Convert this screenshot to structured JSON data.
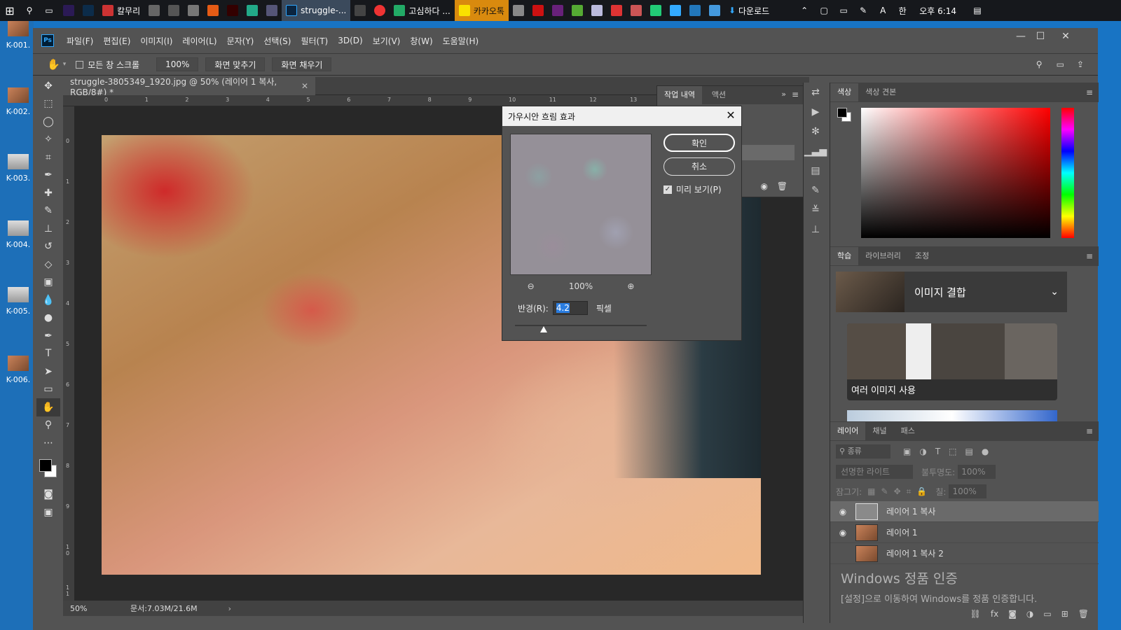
{
  "taskbar": {
    "apps": [
      "칼무리",
      "struggle-...",
      "고심하다 ...",
      "카카오톡",
      "다운로드"
    ],
    "time": "오후 6:14"
  },
  "desktop": {
    "icons": [
      "K-001.",
      "K-002.",
      "K-003.",
      "K-004.",
      "K-005.",
      "K-006."
    ]
  },
  "menubar": {
    "logo": "Ps",
    "items": [
      "파일(F)",
      "편집(E)",
      "이미지(I)",
      "레이어(L)",
      "문자(Y)",
      "선택(S)",
      "필터(T)",
      "3D(D)",
      "보기(V)",
      "창(W)",
      "도움말(H)"
    ]
  },
  "options": {
    "scroll_all_windows": "모든 창 스크롤",
    "zoom": "100%",
    "fit_screen": "화면 맞추기",
    "fill_screen": "화면 채우기"
  },
  "document": {
    "tab_title": "struggle-3805349_1920.jpg @ 50% (레이어 1 복사, RGB/8#) *",
    "zoom": "50%",
    "doc_size": "문서:7.03M/21.6M"
  },
  "rulers": {
    "top": [
      "0",
      "1",
      "2",
      "3",
      "4",
      "5",
      "6",
      "7",
      "8",
      "9",
      "10",
      "11",
      "12",
      "13"
    ],
    "left": [
      "0",
      "1",
      "2",
      "3",
      "4",
      "5",
      "6",
      "7",
      "8",
      "9",
      "1 0",
      "1 1"
    ]
  },
  "history_panel": {
    "tabs": [
      "작업 내역",
      "액션"
    ]
  },
  "dialog": {
    "title": "가우시안 흐림 효과",
    "ok": "확인",
    "cancel": "취소",
    "preview_label": "미리 보기(P)",
    "preview_checked": true,
    "zoom": "100%",
    "radius_label": "반경(R):",
    "radius_value": "4.2",
    "unit": "픽셀"
  },
  "color_panel": {
    "tabs": [
      "색상",
      "색상 견본"
    ]
  },
  "learn_panel": {
    "tabs": [
      "학습",
      "라이브러리",
      "조정"
    ],
    "section": "이미지 결합",
    "card": "여러 이미지 사용"
  },
  "layers_panel": {
    "tabs": [
      "레이어",
      "채널",
      "패스"
    ],
    "filter": "종류",
    "blend_mode": "선명한 라이트",
    "opacity_label": "불투명도:",
    "opacity": "100%",
    "lock_label": "잠그기:",
    "fill_label": "칠:",
    "fill": "100%",
    "layers": [
      {
        "name": "레이어 1 복사",
        "visible": true
      },
      {
        "name": "레이어 1",
        "visible": true
      },
      {
        "name": "레이어 1 복사 2",
        "visible": false
      }
    ]
  },
  "watermark": {
    "line1": "Windows 정품 인증",
    "line2": "[설정]으로 이동하여 Windows를 정품 인증합니다."
  }
}
